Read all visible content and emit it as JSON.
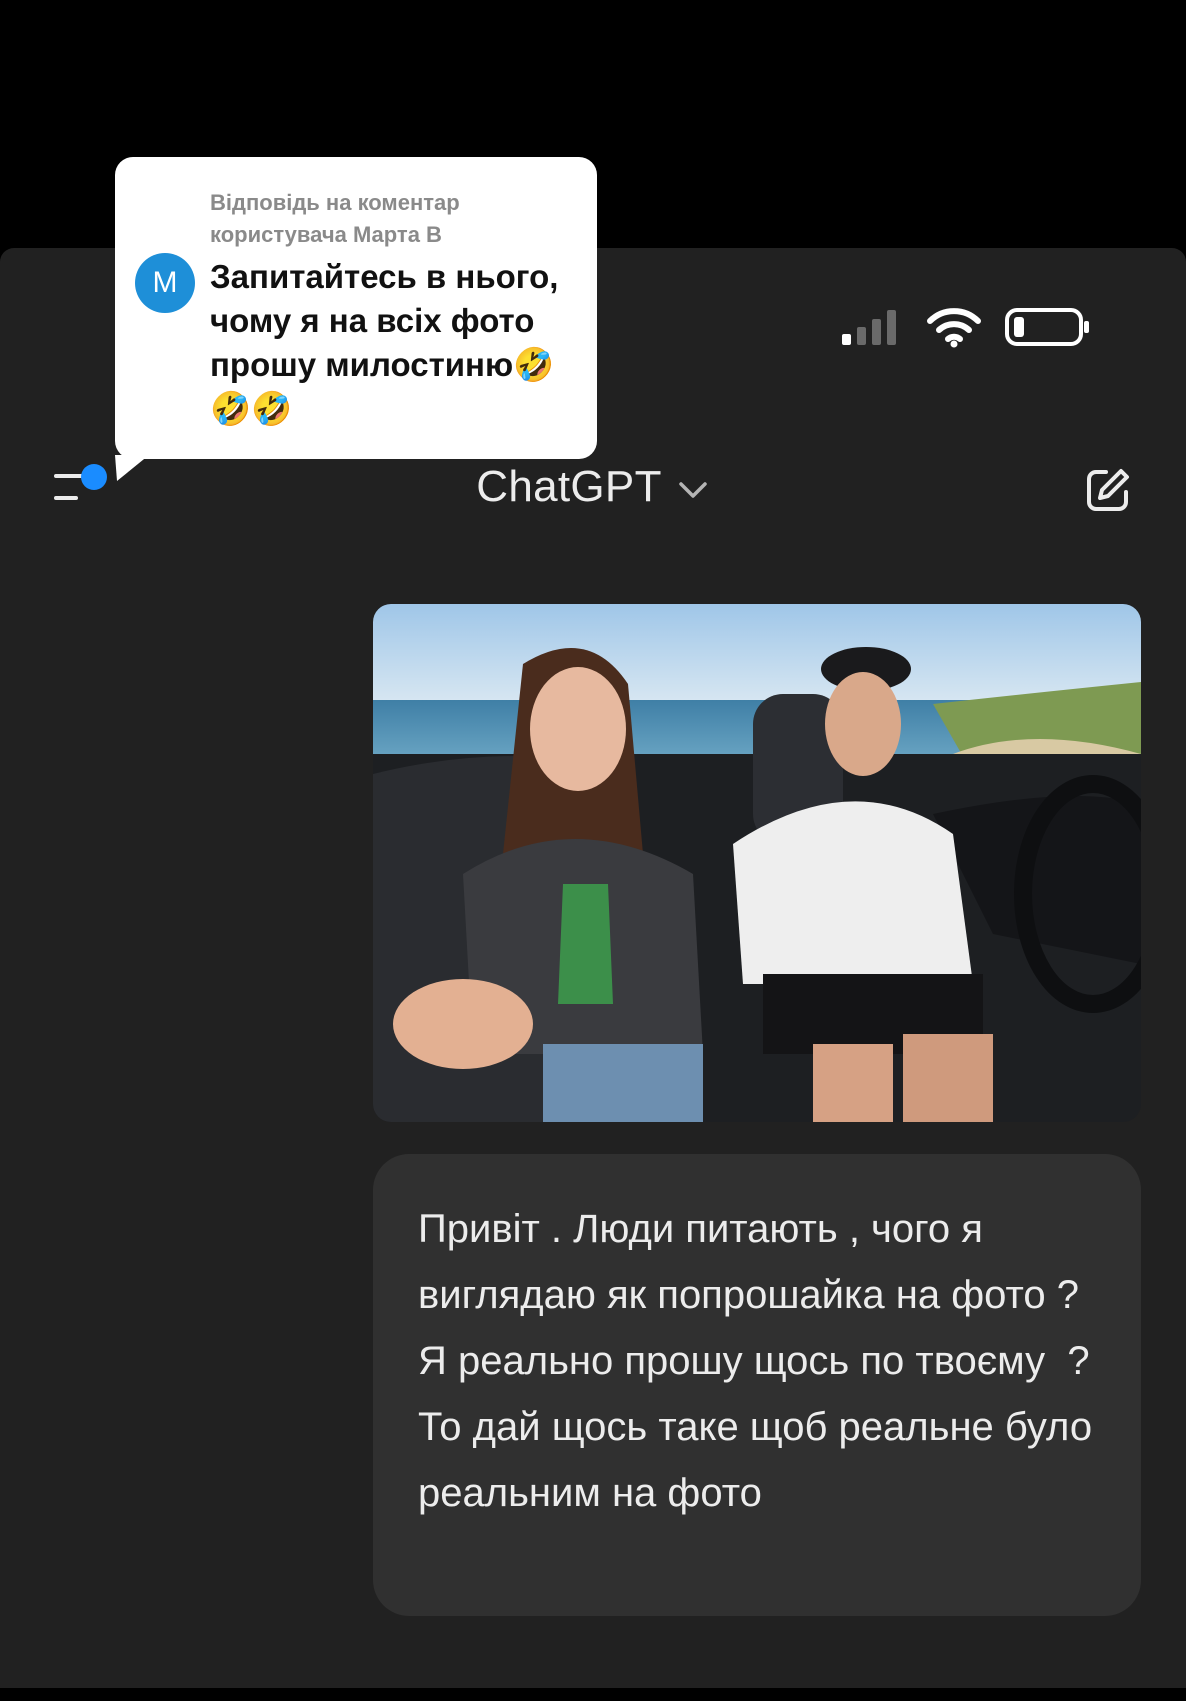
{
  "header": {
    "model_name": "ChatGPT"
  },
  "conversation": {
    "user_message": "Привіт . Люди питають , чого я виглядаю як попрошайка на фото ? Я реально прошу щось по твоєму  ? То дай щось таке щоб реальне було реальним на фото"
  },
  "reply_sticker": {
    "caption_line1": "Відповідь на коментар",
    "caption_line2": "користувача Марта В",
    "avatar_letter": "M",
    "comment_text": "Запитайтесь в нього, чому я на всіх фото прошу милостиню🤣🤣🤣"
  },
  "colors": {
    "app_background": "#212121",
    "bubble_background": "#303030",
    "text_primary": "#ececec",
    "notification_dot": "#1a8cff",
    "sticker_avatar": "#1e8fd8"
  },
  "icons": {
    "status": [
      "signal-icon",
      "wifi-icon",
      "battery-icon"
    ],
    "header_left": "sidebar-menu-icon",
    "header_right": "new-chat-icon"
  }
}
